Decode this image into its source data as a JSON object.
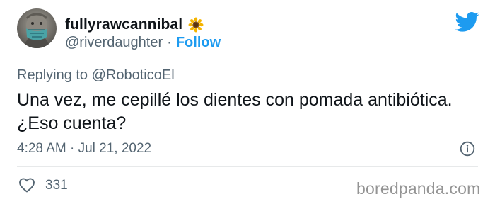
{
  "tweet": {
    "display_name": "fullyrawcannibal",
    "name_emoji": "sunflower",
    "handle": "@riverdaughter",
    "separator": "·",
    "follow_label": "Follow",
    "reply_prefix": "Replying to",
    "reply_to": "@RoboticoEl",
    "text_lines": [
      "Una vez, me cepillé los dientes con pomada antibiótica.",
      "¿Eso cuenta?"
    ],
    "timestamp": "4:28 AM · Jul 21, 2022",
    "like_count": "331"
  },
  "watermark": "boredpanda.com",
  "icons": {
    "logo": "twitter-bird-icon",
    "info": "info-icon",
    "like": "heart-icon"
  },
  "colors": {
    "accent": "#1d9bf0",
    "text": "#0f1419",
    "secondary": "#536471",
    "divider": "#e7e9ea",
    "watermark": "#949494"
  }
}
